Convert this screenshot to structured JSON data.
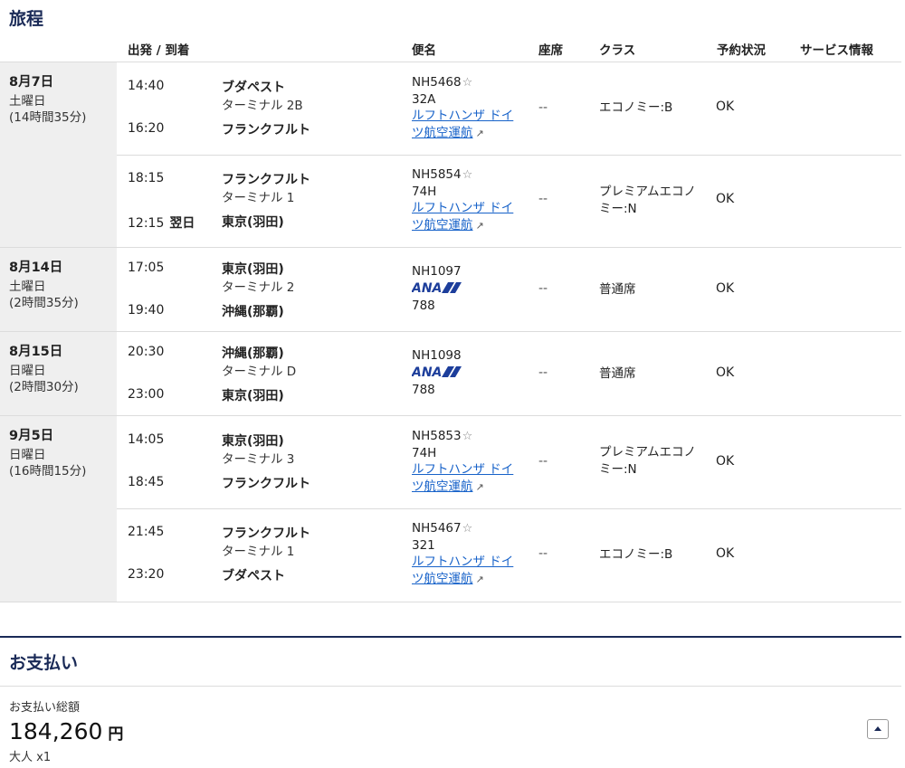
{
  "itinerary": {
    "title": "旅程",
    "headers": {
      "dep_arr": "出発 / 到着",
      "flight": "便名",
      "seat": "座席",
      "class": "クラス",
      "status": "予約状況",
      "service": "サービス情報"
    },
    "groups": [
      {
        "date": "8月7日",
        "dow": "土曜日",
        "duration": "(14時間35分)",
        "segments": [
          {
            "dep_time": "14:40",
            "dep_airport": "ブダペスト",
            "dep_terminal": "ターミナル 2B",
            "arr_time": "16:20",
            "arr_next": "",
            "arr_airport": "フランクフルト",
            "flight": "NH5468",
            "sub": "32A",
            "op1": "ルフトハンザ ドイ",
            "op2": "ツ航空運航",
            "seat": "--",
            "class1": "エコノミー:B",
            "class2": "",
            "status": "OK"
          },
          {
            "dep_time": "18:15",
            "dep_airport": "フランクフルト",
            "dep_terminal": "ターミナル 1",
            "arr_time": "12:15",
            "arr_next": "翌日",
            "arr_airport": "東京(羽田)",
            "flight": "NH5854",
            "sub": "74H",
            "op1": "ルフトハンザ ドイ",
            "op2": "ツ航空運航",
            "seat": "--",
            "class1": "プレミアムエコノ",
            "class2": "ミー:N",
            "status": "OK"
          }
        ]
      },
      {
        "date": "8月14日",
        "dow": "土曜日",
        "duration": "(2時間35分)",
        "segments": [
          {
            "dep_time": "17:05",
            "dep_airport": "東京(羽田)",
            "dep_terminal": "ターミナル 2",
            "arr_time": "19:40",
            "arr_next": "",
            "arr_airport": "沖縄(那覇)",
            "flight": "NH1097",
            "logo": "ANA",
            "sub": "788",
            "seat": "--",
            "class1": "普通席",
            "status": "OK"
          }
        ]
      },
      {
        "date": "8月15日",
        "dow": "日曜日",
        "duration": "(2時間30分)",
        "segments": [
          {
            "dep_time": "20:30",
            "dep_airport": "沖縄(那覇)",
            "dep_terminal": "ターミナル D",
            "arr_time": "23:00",
            "arr_next": "",
            "arr_airport": "東京(羽田)",
            "flight": "NH1098",
            "logo": "ANA",
            "sub": "788",
            "seat": "--",
            "class1": "普通席",
            "status": "OK"
          }
        ]
      },
      {
        "date": "9月5日",
        "dow": "日曜日",
        "duration": "(16時間15分)",
        "segments": [
          {
            "dep_time": "14:05",
            "dep_airport": "東京(羽田)",
            "dep_terminal": "ターミナル 3",
            "arr_time": "18:45",
            "arr_next": "",
            "arr_airport": "フランクフルト",
            "flight": "NH5853",
            "sub": "74H",
            "op1": "ルフトハンザ ドイ",
            "op2": "ツ航空運航",
            "seat": "--",
            "class1": "プレミアムエコノ",
            "class2": "ミー:N",
            "status": "OK"
          },
          {
            "dep_time": "21:45",
            "dep_airport": "フランクフルト",
            "dep_terminal": "ターミナル 1",
            "arr_time": "23:20",
            "arr_next": "",
            "arr_airport": "ブダペスト",
            "flight": "NH5467",
            "sub": "321",
            "op1": "ルフトハンザ ドイ",
            "op2": "ツ航空運航",
            "seat": "--",
            "class1": "エコノミー:B",
            "class2": "",
            "status": "OK"
          }
        ]
      }
    ]
  },
  "payment": {
    "title": "お支払い",
    "total_label": "お支払い総額",
    "amount": "184,260",
    "currency": "円",
    "passengers": "大人 x1"
  },
  "icons": {
    "star": "star-outline-icon",
    "external": "external-link-icon",
    "scroll_top": "chevron-up-icon"
  },
  "colors": {
    "brand_navy": "#1a2a57",
    "link_blue": "#1762c9",
    "date_bg": "#efefef",
    "ana_blue": "#1d3e9b"
  }
}
